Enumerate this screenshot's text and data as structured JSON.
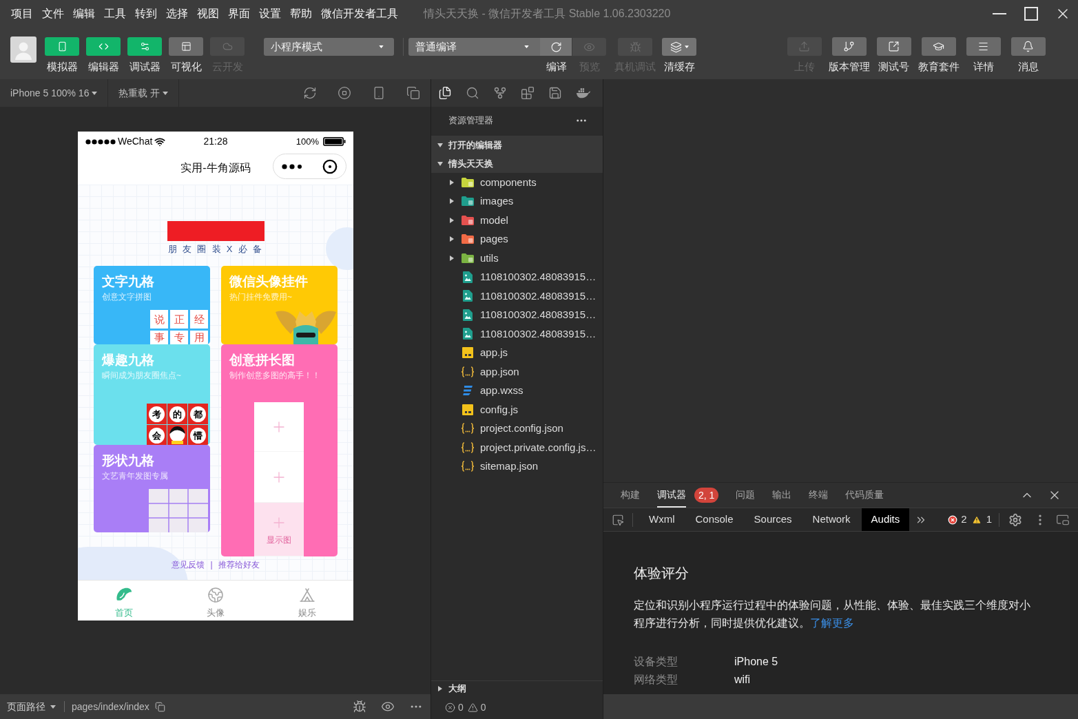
{
  "window": {
    "title": "情头天天换 - 微信开发者工具 Stable 1.06.2303220"
  },
  "menu": [
    "项目",
    "文件",
    "编辑",
    "工具",
    "转到",
    "选择",
    "视图",
    "界面",
    "设置",
    "帮助",
    "微信开发者工具"
  ],
  "toolbar": {
    "view_toggles": [
      {
        "label": "模拟器",
        "on": true,
        "disabled": false
      },
      {
        "label": "编辑器",
        "on": true,
        "disabled": false
      },
      {
        "label": "调试器",
        "on": true,
        "disabled": false
      },
      {
        "label": "可视化",
        "on": false,
        "disabled": false
      },
      {
        "label": "云开发",
        "on": false,
        "disabled": true
      }
    ],
    "mode_select": "小程序模式",
    "compile_select": "普通编译",
    "compile_actions": [
      {
        "label": "编译",
        "disabled": false
      },
      {
        "label": "预览",
        "disabled": true
      },
      {
        "label": "真机调试",
        "disabled": true
      },
      {
        "label": "清缓存",
        "disabled": false
      }
    ],
    "right_actions": [
      {
        "label": "上传",
        "disabled": true
      },
      {
        "label": "版本管理",
        "disabled": false
      },
      {
        "label": "测试号",
        "disabled": false
      },
      {
        "label": "教育套件",
        "disabled": false
      },
      {
        "label": "详情",
        "disabled": false
      },
      {
        "label": "消息",
        "disabled": false
      }
    ]
  },
  "simulator": {
    "device": "iPhone 5 100% 16",
    "hot_reload": "热重载 开",
    "phone": {
      "carrier": "WeChat",
      "time": "21:28",
      "battery": "100%",
      "title": "实用-牛角源码",
      "tagline": "朋 友 圈 装 X 必 备",
      "card_columns": [
        [
          {
            "kind": "text_grid",
            "title": "文字九格",
            "subtitle": "创意文字拼图",
            "color": "#38b7f7",
            "tiles": [
              {
                "kind": "char",
                "text": "说"
              },
              {
                "kind": "char",
                "text": "正"
              },
              {
                "kind": "char",
                "text": "经"
              },
              {
                "kind": "char",
                "text": "事"
              },
              {
                "kind": "char",
                "text": "专"
              },
              {
                "kind": "char",
                "text": "用"
              }
            ]
          },
          {
            "kind": "emoji_grid",
            "title": "爆趣九格",
            "subtitle": "瞬间成为朋友圈焦点~",
            "color": "#6be0ed",
            "tiles": [
              {
                "kind": "char",
                "text": "考"
              },
              {
                "kind": "char",
                "text": "的"
              },
              {
                "kind": "char",
                "text": "都"
              },
              {
                "kind": "char",
                "text": "会"
              },
              {
                "kind": "face"
              },
              {
                "kind": "char",
                "text": "懵"
              }
            ]
          },
          {
            "kind": "photo_grid",
            "title": "形状九格",
            "subtitle": "文艺青年发图专属",
            "color": "#a97ef6"
          }
        ],
        [
          {
            "kind": "pendant",
            "title": "微信头像挂件",
            "subtitle": "热门挂件免费用~",
            "color": "#ffc905"
          },
          {
            "kind": "long_image",
            "title": "创意拼长图",
            "subtitle": "制作创意多图的高手！！",
            "color": "#ff6db4",
            "slots": [
              {
                "kind": "empty"
              },
              {
                "kind": "empty"
              },
              {
                "kind": "preview",
                "label": "显示图"
              }
            ]
          }
        ]
      ],
      "links": [
        "意见反馈",
        "推荐给好友"
      ],
      "link_separator": "|",
      "tabs": [
        {
          "label": "首页",
          "selected": true
        },
        {
          "label": "头像",
          "selected": false
        },
        {
          "label": "娱乐",
          "selected": false
        }
      ]
    }
  },
  "explorer": {
    "activity_bar": [
      {
        "selected": true
      },
      {
        "selected": false
      },
      {
        "selected": false
      },
      {
        "selected": false
      },
      {
        "selected": false
      },
      {
        "selected": false
      }
    ],
    "title": "资源管理器",
    "sections": [
      {
        "label": "打开的编辑器",
        "expanded": true
      },
      {
        "label": "情头天天换",
        "expanded": true,
        "children": [
          {
            "name": "components",
            "kind": "folder",
            "color": "#c6d43d",
            "expanded": false
          },
          {
            "name": "images",
            "kind": "folder",
            "color": "#1f9e8d",
            "expanded": false
          },
          {
            "name": "model",
            "kind": "folder",
            "color": "#e5514f",
            "expanded": false
          },
          {
            "name": "pages",
            "kind": "folder",
            "color": "#f26b46",
            "expanded": false
          },
          {
            "name": "utils",
            "kind": "folder",
            "color": "#7bb342",
            "expanded": false
          },
          {
            "name": "1108100302.48083915…",
            "kind": "image"
          },
          {
            "name": "1108100302.48083915…",
            "kind": "image"
          },
          {
            "name": "1108100302.48083915…",
            "kind": "image"
          },
          {
            "name": "1108100302.48083915…",
            "kind": "image"
          },
          {
            "name": "app.js",
            "kind": "js"
          },
          {
            "name": "app.json",
            "kind": "json"
          },
          {
            "name": "app.wxss",
            "kind": "css"
          },
          {
            "name": "config.js",
            "kind": "js"
          },
          {
            "name": "project.config.json",
            "kind": "json"
          },
          {
            "name": "project.private.config.js…",
            "kind": "json"
          },
          {
            "name": "sitemap.json",
            "kind": "json"
          }
        ]
      }
    ],
    "outline": {
      "label": "大纲",
      "expanded": false
    },
    "problems": {
      "errors": "0",
      "warnings": "0"
    }
  },
  "debugger": {
    "panel_tabs": [
      {
        "label": "构建",
        "selected": false
      },
      {
        "label": "调试器",
        "selected": true,
        "badge": "2, 1"
      },
      {
        "label": "问题",
        "selected": false
      },
      {
        "label": "输出",
        "selected": false
      },
      {
        "label": "终端",
        "selected": false
      },
      {
        "label": "代码质量",
        "selected": false
      }
    ],
    "devtools_tabs": [
      {
        "label": "Wxml",
        "selected": false
      },
      {
        "label": "Console",
        "selected": false
      },
      {
        "label": "Sources",
        "selected": false
      },
      {
        "label": "Network",
        "selected": false
      },
      {
        "label": "Audits",
        "selected": true
      }
    ],
    "error_count": "2",
    "warning_count": "1",
    "audits": {
      "heading": "体验评分",
      "description": "定位和识别小程序运行过程中的体验问题，从性能、体验、最佳实践三个维度对小程序进行分析，同时提供优化建议。",
      "link": "了解更多",
      "info": [
        {
          "label": "设备类型",
          "value": "iPhone 5"
        },
        {
          "label": "网络类型",
          "value": "wifi"
        }
      ]
    }
  },
  "status_bar": {
    "page_path_label": "页面路径",
    "page_path": "pages/index/index"
  }
}
